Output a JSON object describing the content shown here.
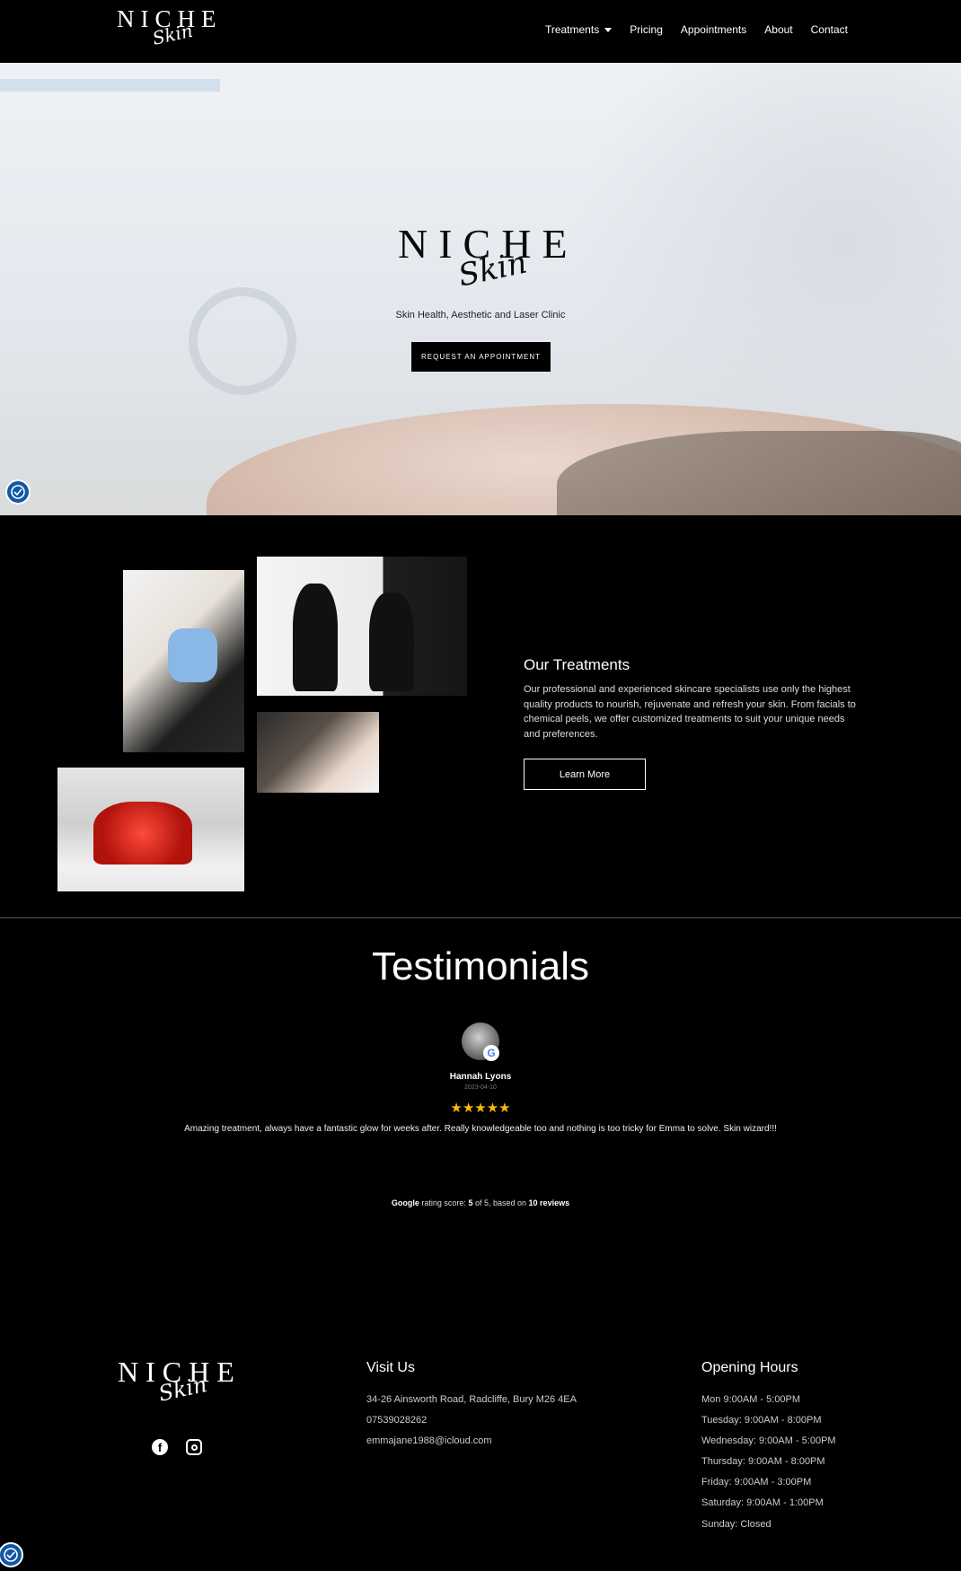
{
  "brand": {
    "word": "NICHE",
    "script": "Skin"
  },
  "nav": {
    "items": [
      {
        "label": "Treatments",
        "has_dropdown": true
      },
      {
        "label": "Pricing"
      },
      {
        "label": "Appointments"
      },
      {
        "label": "About"
      },
      {
        "label": "Contact"
      }
    ]
  },
  "hero": {
    "tagline": "Skin Health, Aesthetic and Laser Clinic",
    "cta_label": "REQUEST AN APPOINTMENT"
  },
  "treatments": {
    "title": "Our Treatments",
    "description": "Our professional and experienced skincare specialists use only the highest quality products to nourish, rejuvenate and refresh your skin. From facials to chemical peels, we offer customized treatments to suit your unique needs and preferences.",
    "button_label": "Learn More"
  },
  "testimonials": {
    "title": "Testimonials",
    "review": {
      "name": "Hannah Lyons",
      "date": "2023-04-10",
      "stars": "★★★★★",
      "rating": 5,
      "text": "Amazing treatment, always have a fantastic glow for weeks after. Really knowledgeable too and nothing is too tricky for Emma to solve. Skin wizard!!!"
    },
    "summary": {
      "source": "Google",
      "prefix": "rating score:",
      "score": "5",
      "mid": "of 5, based on",
      "count": "10 reviews"
    }
  },
  "footer": {
    "visit": {
      "title": "Visit Us",
      "address": "34-26 Ainsworth Road, Radcliffe, Bury M26 4EA",
      "phone": "07539028262",
      "email": "emmajane1988@icloud.com"
    },
    "hours": {
      "title": "Opening Hours",
      "lines": [
        "Mon 9:00AM - 5:00PM",
        "Tuesday: 9:00AM - 8:00PM",
        "Wednesday: 9:00AM - 5:00PM",
        "Thursday: 9:00AM - 8:00PM",
        "Friday: 9:00AM - 3:00PM",
        "Saturday: 9:00AM - 1:00PM",
        "Sunday: Closed"
      ]
    },
    "social": [
      "facebook-icon",
      "instagram-icon"
    ]
  },
  "colors": {
    "background": "#000000",
    "star": "#f6bb06",
    "accessibility": "#1256a6"
  }
}
